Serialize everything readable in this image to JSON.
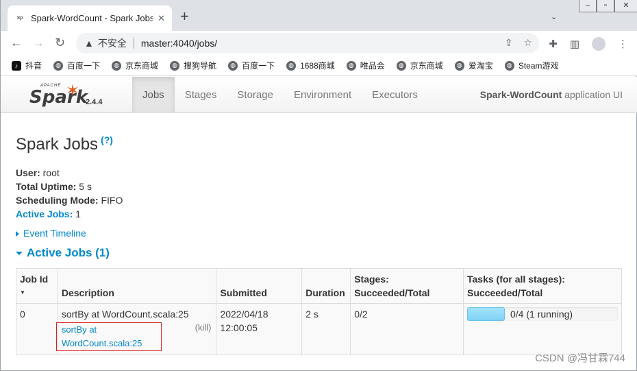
{
  "browser": {
    "tab_title": "Spark-WordCount - Spark Jobs",
    "tab_favicon": "spark-icon",
    "insecure_label": "不安全",
    "url": "master:4040/jobs/",
    "bookmarks": [
      {
        "label": "抖音",
        "icon": "tiktok-icon"
      },
      {
        "label": "百度一下",
        "icon": "globe-icon"
      },
      {
        "label": "京东商城",
        "icon": "globe-icon"
      },
      {
        "label": "搜狗导航",
        "icon": "globe-icon"
      },
      {
        "label": "百度一下",
        "icon": "globe-icon"
      },
      {
        "label": "1688商城",
        "icon": "globe-icon"
      },
      {
        "label": "唯品会",
        "icon": "globe-icon"
      },
      {
        "label": "京东商城",
        "icon": "globe-icon"
      },
      {
        "label": "爱淘宝",
        "icon": "globe-icon"
      },
      {
        "label": "Steam游戏",
        "icon": "globe-icon"
      }
    ]
  },
  "spark_nav": {
    "version": "2.4.4",
    "tabs": [
      {
        "label": "Jobs",
        "active": true
      },
      {
        "label": "Stages",
        "active": false
      },
      {
        "label": "Storage",
        "active": false
      },
      {
        "label": "Environment",
        "active": false
      },
      {
        "label": "Executors",
        "active": false
      }
    ],
    "app_name": "Spark-WordCount",
    "app_suffix": " application UI"
  },
  "page": {
    "title": "Spark Jobs",
    "help": "(?)",
    "user_label": "User:",
    "user_value": " root",
    "uptime_label": "Total Uptime:",
    "uptime_value": " 5 s",
    "mode_label": "Scheduling Mode:",
    "mode_value": " FIFO",
    "active_jobs_label": "Active Jobs:",
    "active_jobs_value": " 1",
    "event_timeline": "Event Timeline",
    "active_jobs_heading": "Active Jobs (1)"
  },
  "table": {
    "headers": {
      "job_id": "Job Id",
      "description": "Description",
      "submitted": "Submitted",
      "duration": "Duration",
      "stages_1": "Stages:",
      "stages_2": "Succeeded/Total",
      "tasks_1": "Tasks (for all stages):",
      "tasks_2": "Succeeded/Total"
    },
    "rows": [
      {
        "job_id": "0",
        "description": "sortBy at WordCount.scala:25",
        "link_1": "sortBy at",
        "link_2": "WordCount.scala:25",
        "kill": "(kill)",
        "submitted_date": "2022/04/18",
        "submitted_time": "12:00:05",
        "duration": "2 s",
        "stages": "0/2",
        "tasks": "0/4 (1 running)",
        "tasks_running_fraction": 0.25
      }
    ]
  },
  "watermark": "CSDN @冯甘霖744"
}
